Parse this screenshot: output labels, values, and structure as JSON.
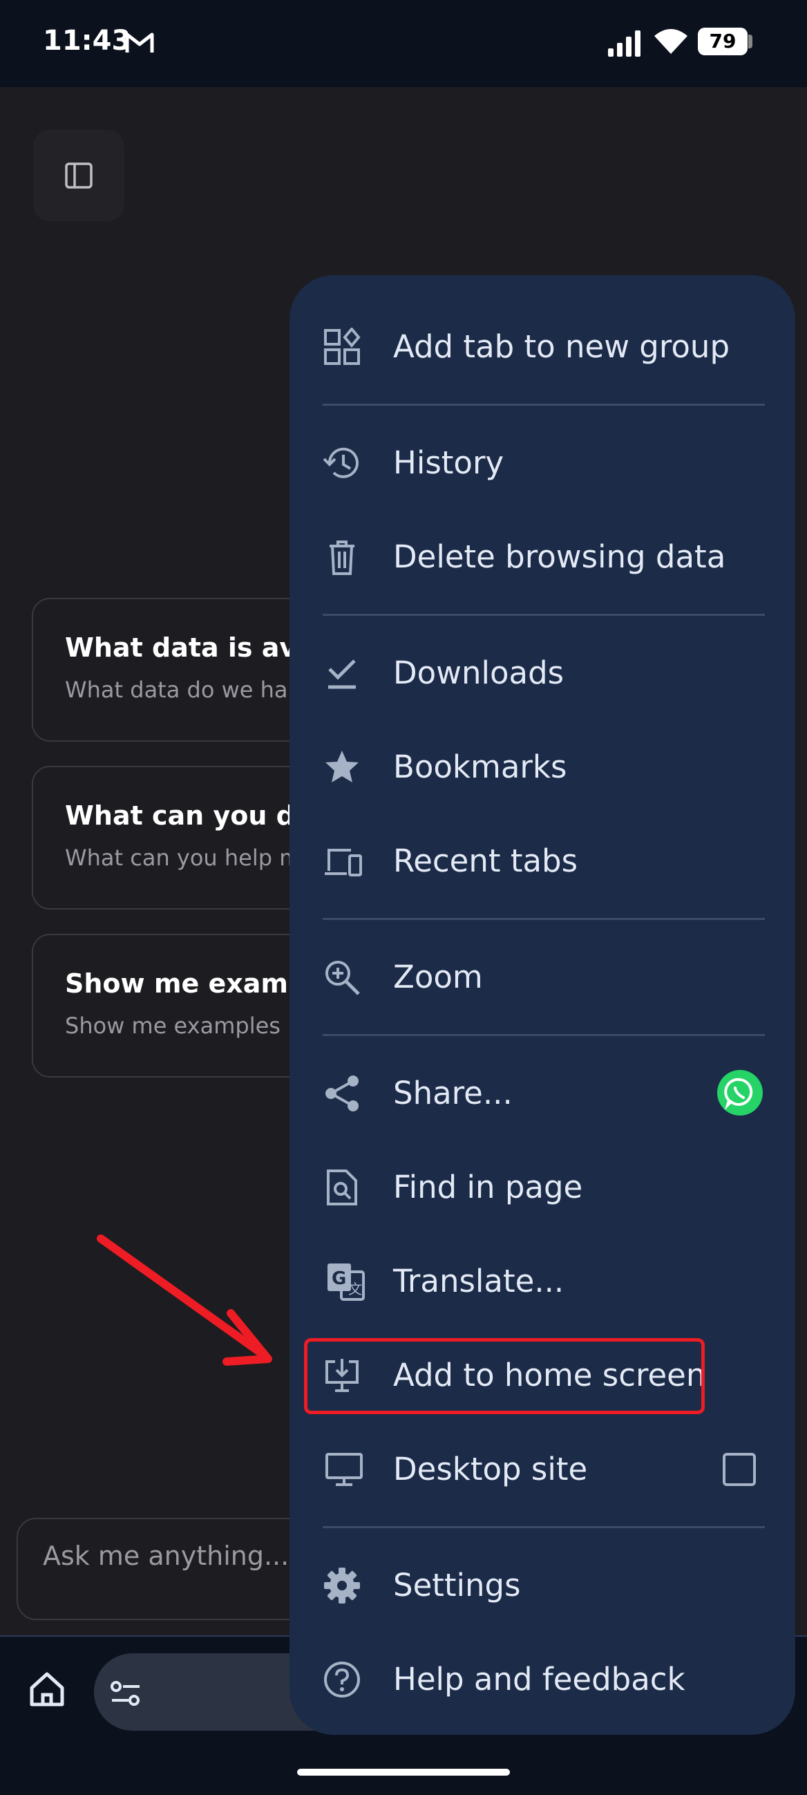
{
  "status_bar": {
    "time": "11:43",
    "battery": "79",
    "icons": [
      "gmail-icon",
      "signal-icon",
      "wifi-icon",
      "battery-icon"
    ]
  },
  "page": {
    "suggestions": [
      {
        "title": "What data is avai",
        "subtitle": "What data do we ha"
      },
      {
        "title": "What can you do?",
        "subtitle": "What can you help m"
      },
      {
        "title": "Show me exampl",
        "subtitle": "Show me examples"
      }
    ],
    "ask_placeholder": "Ask me anything..."
  },
  "menu": {
    "items": [
      {
        "label": "Add tab to new group",
        "icon": "tab-group-icon"
      },
      {
        "label": "History",
        "icon": "history-icon"
      },
      {
        "label": "Delete browsing data",
        "icon": "trash-icon"
      },
      {
        "label": "Downloads",
        "icon": "download-icon"
      },
      {
        "label": "Bookmarks",
        "icon": "star-icon"
      },
      {
        "label": "Recent tabs",
        "icon": "devices-icon"
      },
      {
        "label": "Zoom",
        "icon": "zoom-icon"
      },
      {
        "label": "Share...",
        "icon": "share-icon"
      },
      {
        "label": "Find in page",
        "icon": "find-icon"
      },
      {
        "label": "Translate...",
        "icon": "translate-icon"
      },
      {
        "label": "Add to home screen",
        "icon": "add-to-home-icon"
      },
      {
        "label": "Desktop site",
        "icon": "desktop-icon"
      },
      {
        "label": "Settings",
        "icon": "gear-icon"
      },
      {
        "label": "Help and feedback",
        "icon": "help-icon"
      }
    ],
    "desktop_site_checked": false,
    "highlighted_item": "Add to home screen"
  },
  "colors": {
    "menu_bg": "#1b2b48",
    "page_bg": "#1d1c20",
    "highlight": "#ee1c24",
    "whatsapp": "#25d366"
  }
}
